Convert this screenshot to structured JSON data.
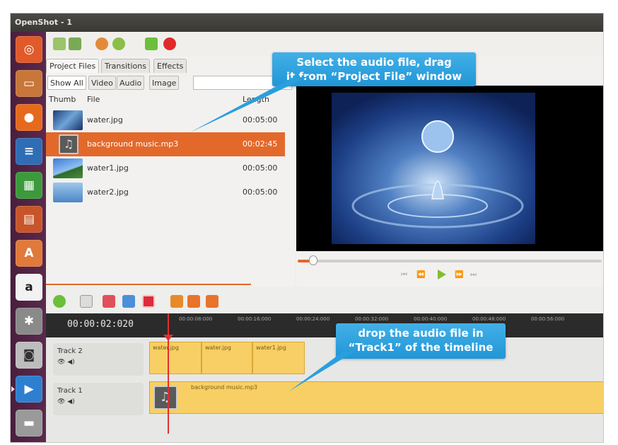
{
  "window": {
    "title": "OpenShot - 1"
  },
  "launcher": {
    "items": [
      {
        "name": "ubuntu-dash",
        "glyph": "◎",
        "color": "#e05a2a"
      },
      {
        "name": "files",
        "glyph": "▭",
        "color": "#d98a3a"
      },
      {
        "name": "firefox",
        "glyph": "●",
        "color": "#e66a1e"
      },
      {
        "name": "writer",
        "glyph": "≡",
        "color": "#2f6db5"
      },
      {
        "name": "calc",
        "glyph": "▦",
        "color": "#3c9a3c"
      },
      {
        "name": "impress",
        "glyph": "▤",
        "color": "#c8552a"
      },
      {
        "name": "software-center",
        "glyph": "A",
        "color": "#e0793a"
      },
      {
        "name": "amazon",
        "glyph": "a",
        "color": "#f2f2f2"
      },
      {
        "name": "settings",
        "glyph": "✱",
        "color": "#b8b8b8"
      },
      {
        "name": "camera",
        "glyph": "◙",
        "color": "#d0d0d0"
      },
      {
        "name": "media-player",
        "glyph": "▶",
        "color": "#2f7fd0"
      },
      {
        "name": "drive",
        "glyph": "▬",
        "color": "#9a9a9a"
      }
    ]
  },
  "project_panel": {
    "tabs": [
      "Project Files",
      "Transitions",
      "Effects"
    ],
    "filters": [
      "Show All",
      "Video",
      "Audio",
      "Image"
    ],
    "columns": {
      "thumb": "Thumb",
      "file": "File",
      "length": "Length"
    },
    "files": [
      {
        "name": "water.jpg",
        "length": "00:05:00",
        "selected": false
      },
      {
        "name": "background music.mp3",
        "length": "00:02:45",
        "selected": true
      },
      {
        "name": "water1.jpg",
        "length": "00:05:00",
        "selected": false
      },
      {
        "name": "water2.jpg",
        "length": "00:05:00",
        "selected": false
      }
    ]
  },
  "preview": {
    "controls": [
      "⏮",
      "⏪",
      "⏩",
      "⏭"
    ]
  },
  "timeline": {
    "timecode": "00:00:02:020",
    "ticks": [
      "00:00:08:000",
      "00:00:16:000",
      "00:00:24:000",
      "00:00:32:000",
      "00:00:40:000",
      "00:00:48:000",
      "00:00:56:000"
    ],
    "tracks": [
      {
        "name": "Track 2",
        "icons": "👁 ◀)",
        "clips": [
          "water.jpg",
          "water.jpg",
          "water1.jpg"
        ]
      },
      {
        "name": "Track 1",
        "icons": "👁 ◀)",
        "clips": [
          "background music.mp3"
        ]
      }
    ]
  },
  "callouts": {
    "top": "Select the audio file, drag it from “Project File” window",
    "top_line1": "Select the audio file, drag",
    "top_line2": "it from “Project File” window",
    "bottom_line1": "drop the audio file in",
    "bottom_line2": "“Track1” of the timeline"
  },
  "colors": {
    "accent": "#e3692b",
    "clip": "#f7cf65",
    "callout": "#2a9fde",
    "playhead": "#e03030"
  }
}
